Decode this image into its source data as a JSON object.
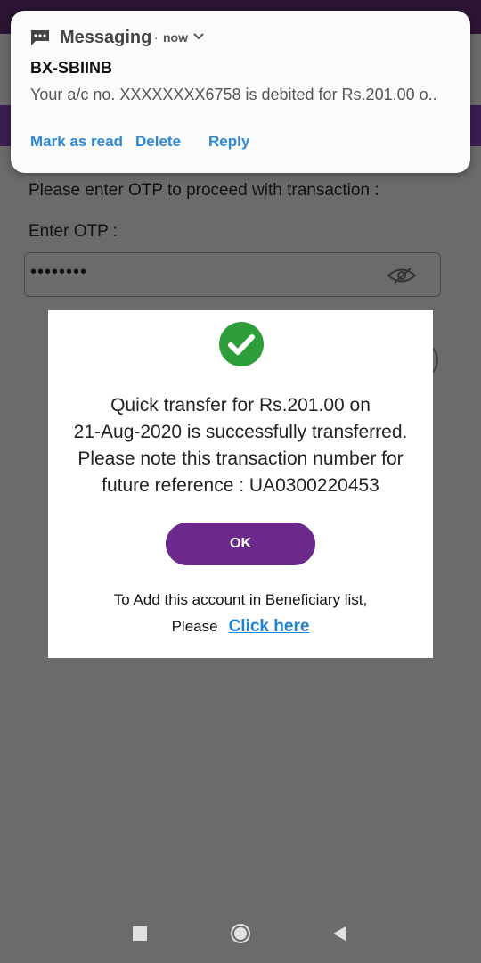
{
  "notification": {
    "app_name": "Messaging",
    "separator": "·",
    "time": "now",
    "sender": "BX-SBIINB",
    "message": "Your a/c no. XXXXXXXX6758 is debited for Rs.201.00 o..",
    "actions": [
      "Mark as read",
      "Delete",
      "Reply"
    ]
  },
  "page": {
    "otp_prompt": "Please enter OTP to proceed with transaction :",
    "otp_label": "Enter OTP :",
    "otp_value": "••••••••"
  },
  "dialog": {
    "message_lines": [
      "Quick transfer for Rs.201.00 on",
      "21-Aug-2020 is successfully transferred.",
      "Please note this transaction number for",
      "future reference : UA0300220453"
    ],
    "ok_label": "OK",
    "add_text": "To Add this account in Beneficiary list,",
    "please_text": "Please",
    "link_text": "Click here"
  },
  "colors": {
    "accent": "#6b2a8b",
    "success": "#2e9e3a",
    "link": "#1e83d0"
  }
}
